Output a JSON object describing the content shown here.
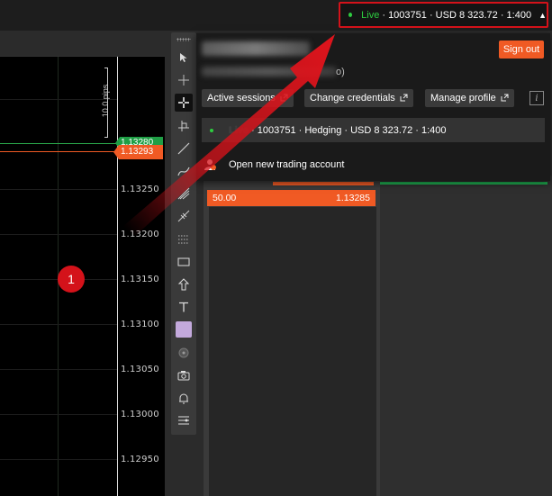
{
  "account_pill": {
    "live": "Live",
    "details": "· 1003751 · USD 8 323.72 · 1:400",
    "caret": "▲"
  },
  "chart": {
    "pips_label": "10.0 pips",
    "price_labels": [
      "1.13250",
      "1.13200",
      "1.13150",
      "1.13100",
      "1.13050",
      "1.13000",
      "1.12950"
    ],
    "bid_tag": "1.13280",
    "ask_tag": "1.13293",
    "step_badge": "1"
  },
  "toolbar": {
    "tools": [
      "cursor-icon",
      "crosshair-icon",
      "move-icon",
      "crosshair-measure-icon",
      "trendline-icon",
      "curve-icon",
      "fibonacci-icon",
      "pitchfork-icon",
      "fib-levels-icon",
      "rectangle-icon",
      "shape-icon",
      "text-icon",
      "color-swatch",
      "circle-icon",
      "camera-icon",
      "alert-icon",
      "settings-list-icon"
    ],
    "swatch_color": "#c3a9dc"
  },
  "dropdown": {
    "user_paren": "o)",
    "sign_out": "Sign out",
    "buttons": {
      "active_sessions": "Active sessions",
      "change_credentials": "Change credentials",
      "manage_profile": "Manage profile"
    },
    "info": "i",
    "account_row": {
      "live": "Live",
      "details": "· 1003751 · Hedging · USD 8 323.72 · 1:400"
    },
    "open_new": "Open new trading account"
  },
  "order_row": {
    "qty": "50.00",
    "price": "1.13285"
  },
  "colors": {
    "accent_orange": "#f05a24",
    "live_green": "#2ecc40",
    "highlight_red": "#d4121a"
  }
}
